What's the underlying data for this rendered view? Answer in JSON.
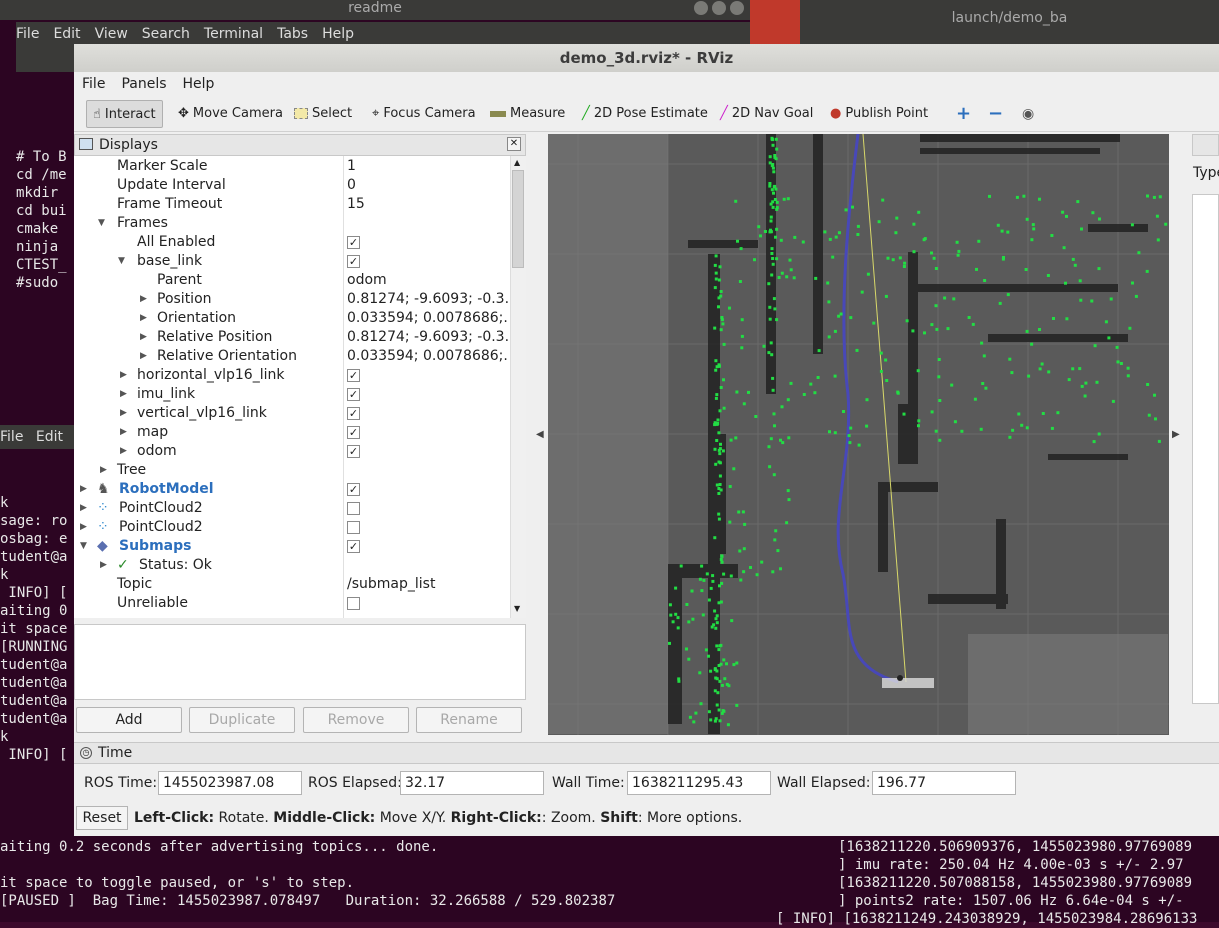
{
  "bg_term1": {
    "title": "readme",
    "menu": [
      "File",
      "Edit",
      "View",
      "Search",
      "Terminal",
      "Tabs",
      "Help"
    ],
    "lines": [
      "# To B",
      "cd /me",
      "mkdir",
      "cd bui",
      "cmake",
      "ninja",
      "",
      "",
      "CTEST_",
      "",
      "#sudo"
    ]
  },
  "bg_term2": {
    "title": "launch/demo_ba"
  },
  "bg_term3": {
    "menu": [
      "File",
      "Edit"
    ],
    "lines": [
      "k",
      "sage: ro",
      "",
      "osbag: e",
      "tudent@a",
      "k",
      " INFO] [",
      "",
      "aiting 0",
      "",
      "it space",
      "[RUNNING",
      "",
      "tudent@a",
      "tudent@a",
      "tudent@a",
      "tudent@a",
      "k",
      " INFO] ["
    ]
  },
  "bottom_terminal": {
    "line1": "aiting 0.2 seconds after advertising topics... done.",
    "line2": "it space to toggle paused, or 's' to step.",
    "line3": "[PAUSED ]  Bag Time: 1455023987.078497   Duration: 32.266588 / 529.802387",
    "right1": "[1638211220.506909376, 1455023980.97769089",
    "right2": "] imu rate: 250.04 Hz 4.00e-03 s +/- 2.97",
    "right3": "[1638211220.507088158, 1455023980.97769089",
    "right4": "] points2 rate: 1507.06 Hz 6.64e-04 s +/- ",
    "right5": "[ INFO] [1638211249.243038929, 1455023984.28696133"
  },
  "window": {
    "title": "demo_3d.rviz* - RViz"
  },
  "menubar": {
    "file": "File",
    "panels": "Panels",
    "help": "Help"
  },
  "toolbar": {
    "interact": "Interact",
    "move_camera": "Move Camera",
    "select": "Select",
    "focus_camera": "Focus Camera",
    "measure": "Measure",
    "pose_estimate": "2D Pose Estimate",
    "nav_goal": "2D Nav Goal",
    "publish_point": "Publish Point"
  },
  "displays": {
    "title": "Displays",
    "rows": {
      "marker_scale": {
        "key": "Marker Scale",
        "value": "1"
      },
      "update_interval": {
        "key": "Update Interval",
        "value": "0"
      },
      "frame_timeout": {
        "key": "Frame Timeout",
        "value": "15"
      },
      "frames": {
        "key": "Frames"
      },
      "all_enabled": {
        "key": "All Enabled"
      },
      "base_link": {
        "key": "base_link"
      },
      "parent": {
        "key": "Parent",
        "value": "odom"
      },
      "position": {
        "key": "Position",
        "value": "0.81274; -9.6093; -0.3..."
      },
      "orientation": {
        "key": "Orientation",
        "value": "0.033594; 0.0078686;..."
      },
      "rel_position": {
        "key": "Relative Position",
        "value": "0.81274; -9.6093; -0.3..."
      },
      "rel_orientation": {
        "key": "Relative Orientation",
        "value": "0.033594; 0.0078686;..."
      },
      "horizontal": {
        "key": "horizontal_vlp16_link"
      },
      "imu": {
        "key": "imu_link"
      },
      "vertical": {
        "key": "vertical_vlp16_link"
      },
      "map": {
        "key": "map"
      },
      "odom": {
        "key": "odom"
      },
      "tree": {
        "key": "Tree"
      },
      "robot_model": {
        "key": "RobotModel"
      },
      "pc2a": {
        "key": "PointCloud2"
      },
      "pc2b": {
        "key": "PointCloud2"
      },
      "submaps": {
        "key": "Submaps"
      },
      "status": {
        "key": "Status: Ok"
      },
      "topic": {
        "key": "Topic",
        "value": "/submap_list"
      },
      "unreliable": {
        "key": "Unreliable"
      }
    },
    "buttons": {
      "add": "Add",
      "duplicate": "Duplicate",
      "remove": "Remove",
      "rename": "Rename"
    }
  },
  "right_panel": {
    "type_label": "Type"
  },
  "time": {
    "title": "Time",
    "ros_time_label": "ROS Time:",
    "ros_time": "1455023987.08",
    "ros_elapsed_label": "ROS Elapsed:",
    "ros_elapsed": "32.17",
    "wall_time_label": "Wall Time:",
    "wall_time": "1638211295.43",
    "wall_elapsed_label": "Wall Elapsed:",
    "wall_elapsed": "196.77",
    "reset": "Reset",
    "hint": {
      "b1": "Left-Click:",
      "t1": " Rotate. ",
      "b2": "Middle-Click:",
      "t2": " Move X/Y. ",
      "b3": "Right-Click:",
      "t3": ": Zoom. ",
      "b4": "Shift",
      "t4": ": More options."
    }
  },
  "colors": {
    "accent": "#2c6fbd",
    "points": "#22dd44",
    "path": "#4444bb",
    "grid_bg": "#5a5a5a"
  }
}
